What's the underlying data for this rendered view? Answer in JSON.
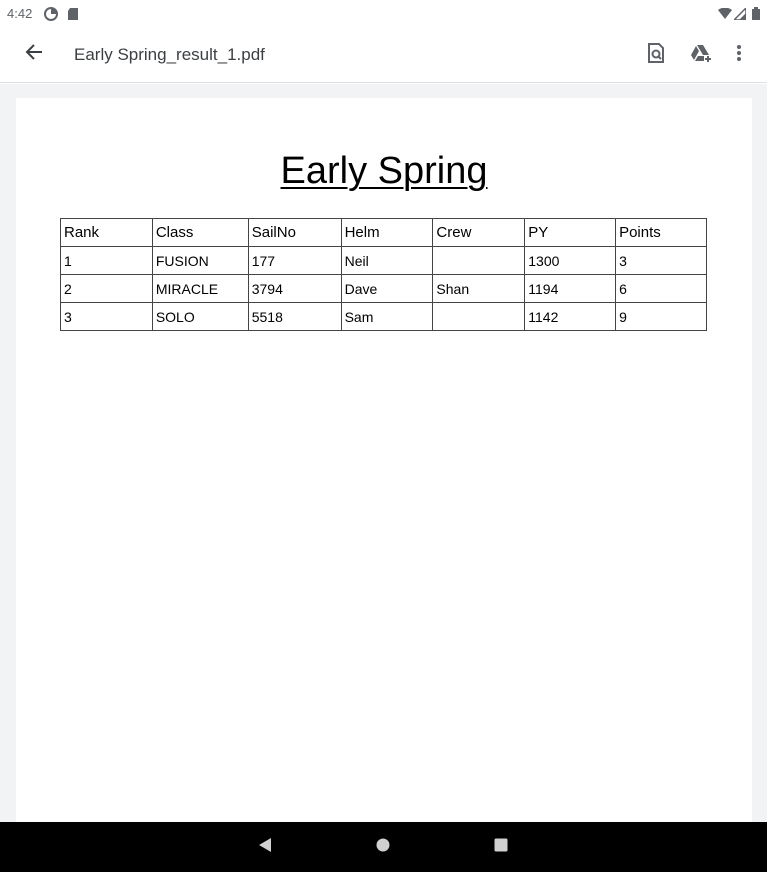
{
  "status_bar": {
    "time": "4:42"
  },
  "app_bar": {
    "title": "Early Spring_result_1.pdf",
    "icons": [
      "back-arrow-icon",
      "find-in-page-icon",
      "add-to-drive-icon",
      "more-vert-icon"
    ]
  },
  "document": {
    "title": "Early Spring",
    "table": {
      "headers": [
        "Rank",
        "Class",
        "SailNo",
        "Helm",
        "Crew",
        "PY",
        "Points"
      ],
      "rows": [
        [
          "1",
          "FUSION",
          "177",
          "Neil",
          "",
          "1300",
          "3"
        ],
        [
          "2",
          "MIRACLE",
          "3794",
          "Dave",
          "Shan",
          "1194",
          "6"
        ],
        [
          "3",
          "SOLO",
          "5518",
          "Sam",
          "",
          "1142",
          "9"
        ]
      ]
    }
  },
  "colors": {
    "app_bar_bg": "#ffffff",
    "viewer_bg": "#f1f3f4",
    "nav_bar_bg": "#000000",
    "icon_color": "#5f6368"
  }
}
